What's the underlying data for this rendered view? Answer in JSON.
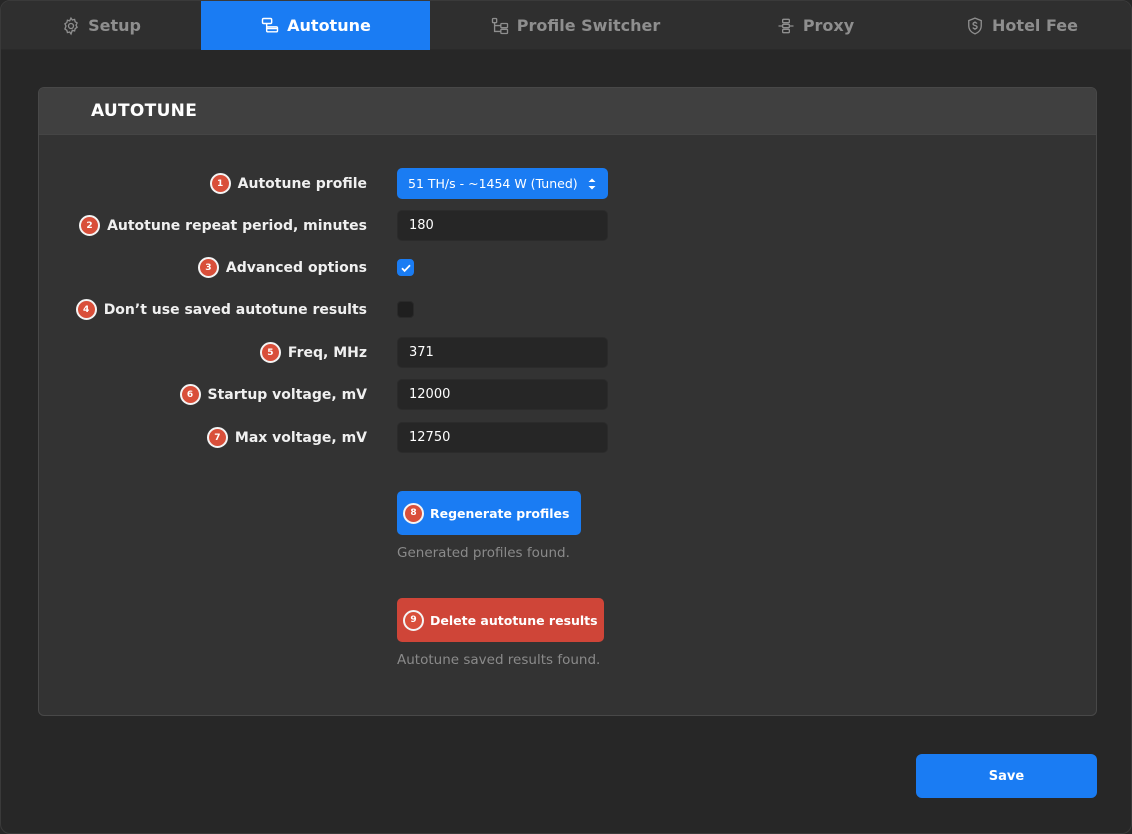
{
  "tabs": {
    "setup": "Setup",
    "autotune": "Autotune",
    "profile_switcher": "Profile Switcher",
    "proxy": "Proxy",
    "hotel_fee": "Hotel Fee"
  },
  "active_tab": "Autotune",
  "card": {
    "title": "AUTOTUNE"
  },
  "form": {
    "autotune_profile": {
      "badge": "1",
      "label": "Autotune profile",
      "value": "51 TH/s - ~1454 W (Tuned)"
    },
    "repeat_period": {
      "badge": "2",
      "label": "Autotune repeat period, minutes",
      "value": "180"
    },
    "advanced_options": {
      "badge": "3",
      "label": "Advanced options",
      "checked": true
    },
    "dont_use_saved": {
      "badge": "4",
      "label": "Don’t use saved autotune results",
      "checked": false
    },
    "freq": {
      "badge": "5",
      "label": "Freq, MHz",
      "value": "371"
    },
    "startup_voltage": {
      "badge": "6",
      "label": "Startup voltage, mV",
      "value": "12000"
    },
    "max_voltage": {
      "badge": "7",
      "label": "Max voltage, mV",
      "value": "12750"
    }
  },
  "actions": {
    "regenerate": {
      "badge": "8",
      "label": "Regenerate profiles",
      "hint": "Generated profiles found."
    },
    "delete": {
      "badge": "9",
      "label": "Delete autotune results",
      "hint": "Autotune saved results found."
    }
  },
  "footer": {
    "save_label": "Save"
  },
  "colors": {
    "accent": "#1a7cf3",
    "danger": "#cf4538",
    "badge": "#d94f3a"
  },
  "icons": {
    "setup": "gear-icon",
    "autotune": "autotune-icon",
    "profile_switcher": "hierarchy-icon",
    "proxy": "proxy-icon",
    "hotel_fee": "shield-dollar-icon"
  }
}
